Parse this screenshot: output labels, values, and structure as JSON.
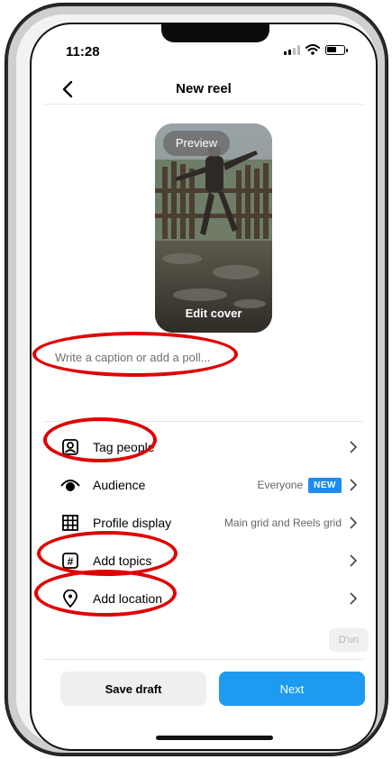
{
  "status_bar": {
    "time": "11:28"
  },
  "header": {
    "title": "New reel",
    "back_icon": "chevron-left-icon"
  },
  "preview": {
    "pill_label": "Preview",
    "edit_cover_label": "Edit cover"
  },
  "caption": {
    "placeholder": "Write a caption or add a poll..."
  },
  "options": [
    {
      "label": "Tag people",
      "icon": "tag-person-icon",
      "meta": "",
      "badge": ""
    },
    {
      "label": "Audience",
      "icon": "eye-icon",
      "meta": "Everyone",
      "badge": "NEW"
    },
    {
      "label": "Profile display",
      "icon": "grid-icon",
      "meta": "Main grid and Reels grid",
      "badge": ""
    },
    {
      "label": "Add topics",
      "icon": "hashtag-icon",
      "meta": "",
      "badge": ""
    },
    {
      "label": "Add location",
      "icon": "location-pin-icon",
      "meta": "",
      "badge": ""
    }
  ],
  "mini_chip": {
    "label": "D'un"
  },
  "actions": {
    "save_draft": "Save draft",
    "next": "Next"
  },
  "colors": {
    "accent": "#1d9bf0",
    "badge": "#1c8cf0",
    "highlight": "#e00000"
  }
}
